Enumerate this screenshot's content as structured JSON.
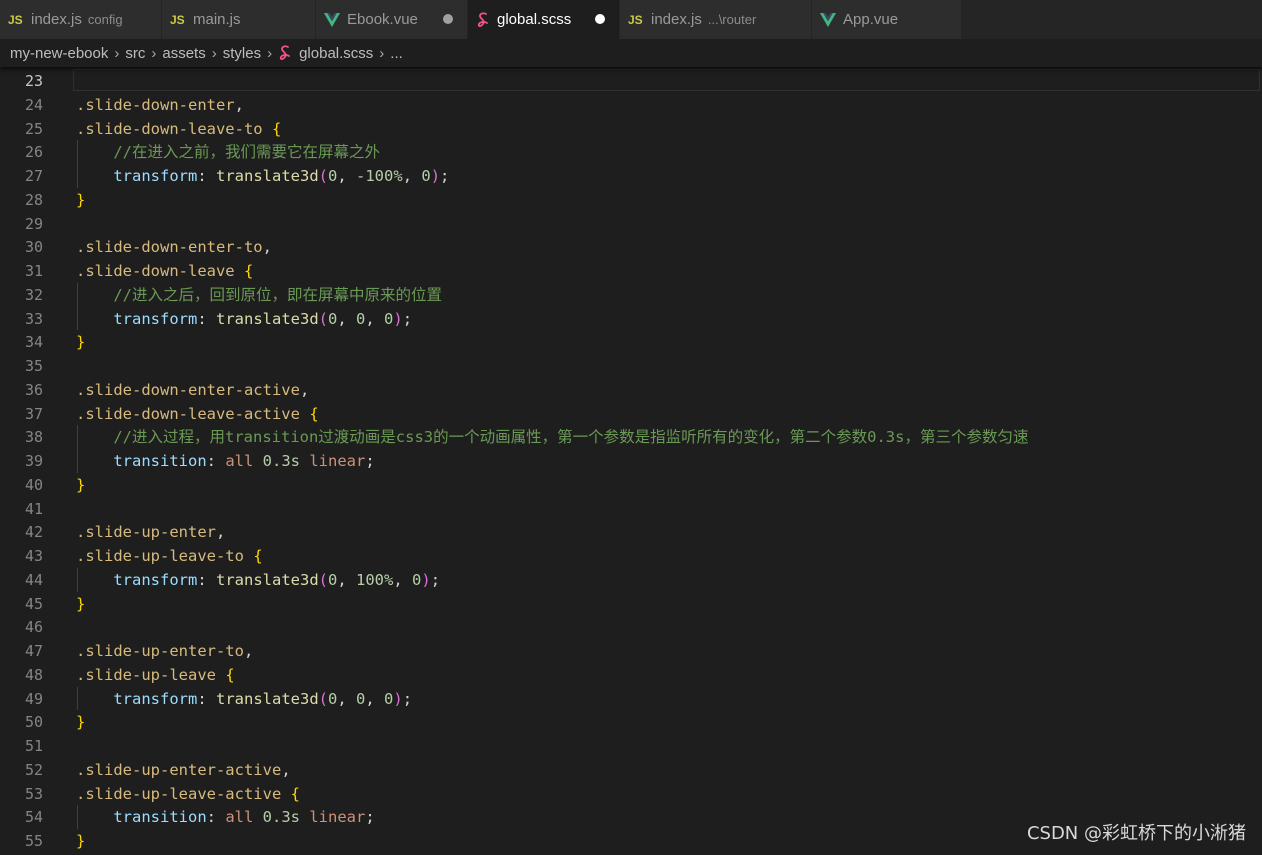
{
  "tabs": [
    {
      "icon": "js-file-icon",
      "label": "index.js",
      "desc": "config",
      "active": false,
      "dirty": false
    },
    {
      "icon": "js-file-icon",
      "label": "main.js",
      "desc": "",
      "active": false,
      "dirty": false
    },
    {
      "icon": "vue-file-icon",
      "label": "Ebook.vue",
      "desc": "",
      "active": false,
      "dirty": true
    },
    {
      "icon": "scss-file-icon",
      "label": "global.scss",
      "desc": "",
      "active": true,
      "dirty": true
    },
    {
      "icon": "js-file-icon",
      "label": "index.js",
      "desc": "...\\router",
      "active": false,
      "dirty": false
    },
    {
      "icon": "vue-file-icon",
      "label": "App.vue",
      "desc": "",
      "active": false,
      "dirty": false
    }
  ],
  "js_badge": "JS",
  "breadcrumb": [
    "my-new-ebook",
    "src",
    "assets",
    "styles",
    "global.scss",
    "..."
  ],
  "lines": [
    {
      "n": "23",
      "current": true,
      "tokens": []
    },
    {
      "n": "24",
      "tokens": [
        {
          "t": ".slide-down-enter",
          "c": "sel"
        },
        {
          "t": ",",
          "c": "plain"
        }
      ]
    },
    {
      "n": "25",
      "tokens": [
        {
          "t": ".slide-down-leave-to",
          "c": "sel"
        },
        {
          "t": " ",
          "c": "plain"
        },
        {
          "t": "{",
          "c": "brace"
        }
      ]
    },
    {
      "n": "26",
      "tokens": [
        {
          "t": "    //在进入之前，我们需要它在屏幕之外",
          "c": "cmt"
        }
      ]
    },
    {
      "n": "27",
      "tokens": [
        {
          "t": "    ",
          "c": "plain"
        },
        {
          "t": "transform",
          "c": "prop"
        },
        {
          "t": ": ",
          "c": "plain"
        },
        {
          "t": "translate3d",
          "c": "fn"
        },
        {
          "t": "(",
          "c": "paren"
        },
        {
          "t": "0",
          "c": "num"
        },
        {
          "t": ", ",
          "c": "plain"
        },
        {
          "t": "-100%",
          "c": "num"
        },
        {
          "t": ", ",
          "c": "plain"
        },
        {
          "t": "0",
          "c": "num"
        },
        {
          "t": ")",
          "c": "paren"
        },
        {
          "t": ";",
          "c": "plain"
        }
      ]
    },
    {
      "n": "28",
      "tokens": [
        {
          "t": "}",
          "c": "brace"
        }
      ]
    },
    {
      "n": "29",
      "tokens": []
    },
    {
      "n": "30",
      "tokens": [
        {
          "t": ".slide-down-enter-to",
          "c": "sel"
        },
        {
          "t": ",",
          "c": "plain"
        }
      ]
    },
    {
      "n": "31",
      "tokens": [
        {
          "t": ".slide-down-leave",
          "c": "sel"
        },
        {
          "t": " ",
          "c": "plain"
        },
        {
          "t": "{",
          "c": "brace"
        }
      ]
    },
    {
      "n": "32",
      "tokens": [
        {
          "t": "    //进入之后，回到原位，即在屏幕中原来的位置",
          "c": "cmt"
        }
      ]
    },
    {
      "n": "33",
      "tokens": [
        {
          "t": "    ",
          "c": "plain"
        },
        {
          "t": "transform",
          "c": "prop"
        },
        {
          "t": ": ",
          "c": "plain"
        },
        {
          "t": "translate3d",
          "c": "fn"
        },
        {
          "t": "(",
          "c": "paren"
        },
        {
          "t": "0",
          "c": "num"
        },
        {
          "t": ", ",
          "c": "plain"
        },
        {
          "t": "0",
          "c": "num"
        },
        {
          "t": ", ",
          "c": "plain"
        },
        {
          "t": "0",
          "c": "num"
        },
        {
          "t": ")",
          "c": "paren"
        },
        {
          "t": ";",
          "c": "plain"
        }
      ]
    },
    {
      "n": "34",
      "tokens": [
        {
          "t": "}",
          "c": "brace"
        }
      ]
    },
    {
      "n": "35",
      "tokens": []
    },
    {
      "n": "36",
      "tokens": [
        {
          "t": ".slide-down-enter-active",
          "c": "sel"
        },
        {
          "t": ",",
          "c": "plain"
        }
      ]
    },
    {
      "n": "37",
      "tokens": [
        {
          "t": ".slide-down-leave-active",
          "c": "sel"
        },
        {
          "t": " ",
          "c": "plain"
        },
        {
          "t": "{",
          "c": "brace"
        }
      ]
    },
    {
      "n": "38",
      "tokens": [
        {
          "t": "    //进入过程，用transition过渡动画是css3的一个动画属性，第一个参数是指监听所有的变化，第二个参数0.3s，第三个参数匀速",
          "c": "cmt"
        }
      ]
    },
    {
      "n": "39",
      "tokens": [
        {
          "t": "    ",
          "c": "plain"
        },
        {
          "t": "transition",
          "c": "prop"
        },
        {
          "t": ": ",
          "c": "plain"
        },
        {
          "t": "all",
          "c": "kw"
        },
        {
          "t": " ",
          "c": "plain"
        },
        {
          "t": "0.3s",
          "c": "num"
        },
        {
          "t": " ",
          "c": "plain"
        },
        {
          "t": "linear",
          "c": "kw"
        },
        {
          "t": ";",
          "c": "plain"
        }
      ]
    },
    {
      "n": "40",
      "tokens": [
        {
          "t": "}",
          "c": "brace"
        }
      ]
    },
    {
      "n": "41",
      "tokens": []
    },
    {
      "n": "42",
      "tokens": [
        {
          "t": ".slide-up-enter",
          "c": "sel"
        },
        {
          "t": ",",
          "c": "plain"
        }
      ]
    },
    {
      "n": "43",
      "tokens": [
        {
          "t": ".slide-up-leave-to",
          "c": "sel"
        },
        {
          "t": " ",
          "c": "plain"
        },
        {
          "t": "{",
          "c": "brace"
        }
      ]
    },
    {
      "n": "44",
      "tokens": [
        {
          "t": "    ",
          "c": "plain"
        },
        {
          "t": "transform",
          "c": "prop"
        },
        {
          "t": ": ",
          "c": "plain"
        },
        {
          "t": "translate3d",
          "c": "fn"
        },
        {
          "t": "(",
          "c": "paren"
        },
        {
          "t": "0",
          "c": "num"
        },
        {
          "t": ", ",
          "c": "plain"
        },
        {
          "t": "100%",
          "c": "num"
        },
        {
          "t": ", ",
          "c": "plain"
        },
        {
          "t": "0",
          "c": "num"
        },
        {
          "t": ")",
          "c": "paren"
        },
        {
          "t": ";",
          "c": "plain"
        }
      ]
    },
    {
      "n": "45",
      "tokens": [
        {
          "t": "}",
          "c": "brace"
        }
      ]
    },
    {
      "n": "46",
      "tokens": []
    },
    {
      "n": "47",
      "tokens": [
        {
          "t": ".slide-up-enter-to",
          "c": "sel"
        },
        {
          "t": ",",
          "c": "plain"
        }
      ]
    },
    {
      "n": "48",
      "tokens": [
        {
          "t": ".slide-up-leave",
          "c": "sel"
        },
        {
          "t": " ",
          "c": "plain"
        },
        {
          "t": "{",
          "c": "brace"
        }
      ]
    },
    {
      "n": "49",
      "tokens": [
        {
          "t": "    ",
          "c": "plain"
        },
        {
          "t": "transform",
          "c": "prop"
        },
        {
          "t": ": ",
          "c": "plain"
        },
        {
          "t": "translate3d",
          "c": "fn"
        },
        {
          "t": "(",
          "c": "paren"
        },
        {
          "t": "0",
          "c": "num"
        },
        {
          "t": ", ",
          "c": "plain"
        },
        {
          "t": "0",
          "c": "num"
        },
        {
          "t": ", ",
          "c": "plain"
        },
        {
          "t": "0",
          "c": "num"
        },
        {
          "t": ")",
          "c": "paren"
        },
        {
          "t": ";",
          "c": "plain"
        }
      ]
    },
    {
      "n": "50",
      "tokens": [
        {
          "t": "}",
          "c": "brace"
        }
      ]
    },
    {
      "n": "51",
      "tokens": []
    },
    {
      "n": "52",
      "tokens": [
        {
          "t": ".slide-up-enter-active",
          "c": "sel"
        },
        {
          "t": ",",
          "c": "plain"
        }
      ]
    },
    {
      "n": "53",
      "tokens": [
        {
          "t": ".slide-up-leave-active",
          "c": "sel"
        },
        {
          "t": " ",
          "c": "plain"
        },
        {
          "t": "{",
          "c": "brace"
        }
      ]
    },
    {
      "n": "54",
      "tokens": [
        {
          "t": "    ",
          "c": "plain"
        },
        {
          "t": "transition",
          "c": "prop"
        },
        {
          "t": ": ",
          "c": "plain"
        },
        {
          "t": "all",
          "c": "kw"
        },
        {
          "t": " ",
          "c": "plain"
        },
        {
          "t": "0.3s",
          "c": "num"
        },
        {
          "t": " ",
          "c": "plain"
        },
        {
          "t": "linear",
          "c": "kw"
        },
        {
          "t": ";",
          "c": "plain"
        }
      ]
    },
    {
      "n": "55",
      "tokens": [
        {
          "t": "}",
          "c": "brace"
        }
      ]
    }
  ],
  "watermark": "CSDN @彩虹桥下的小淅猪",
  "colors": {
    "editor_bg": "#1e1e1e",
    "tab_bg": "#2d2d2d",
    "selector": "#d7ba7d",
    "brace": "#ffd700",
    "paren": "#da70d6",
    "property": "#9cdcfe",
    "number": "#b5cea8",
    "keyword": "#ce9178",
    "comment": "#6a9955",
    "function": "#dcdcaa",
    "js_icon": "#cbcb41",
    "vue_icon": "#41b883",
    "scss_icon": "#f55385"
  }
}
